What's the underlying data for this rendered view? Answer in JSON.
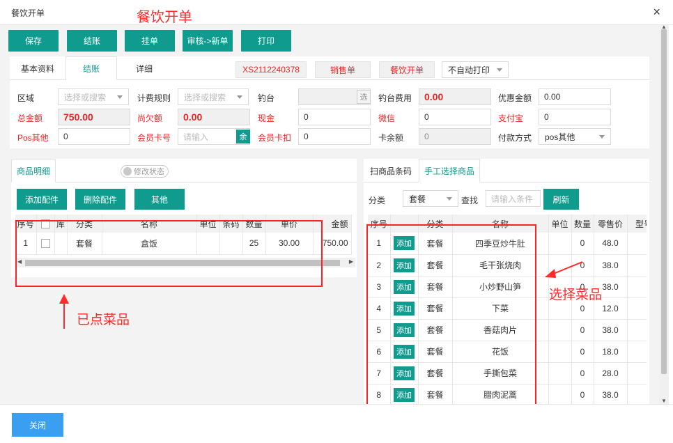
{
  "window": {
    "title": "餐饮开单",
    "close_glyph": "×"
  },
  "annotations": {
    "title": "餐饮开单",
    "ordered_label": "已点菜品",
    "select_label": "选择菜品",
    "color": "#ff2a2a"
  },
  "toolbar": {
    "buttons": [
      "保存",
      "结账",
      "挂单",
      "审核->新单",
      "打印"
    ]
  },
  "top_tabs": [
    "基本资料",
    "结账",
    "详细"
  ],
  "top_chips": [
    "XS2112240378",
    "销售单",
    "餐饮开单"
  ],
  "print_mode": {
    "value": "不自动打印"
  },
  "form": {
    "region": {
      "label": "区域",
      "placeholder": "选择或搜索"
    },
    "billing_rule": {
      "label": "计费规则",
      "placeholder": "选择或搜索"
    },
    "table_seat": {
      "label": "钓台",
      "btn": "选"
    },
    "table_fee": {
      "label": "钓台费用",
      "value": "0.00"
    },
    "discount": {
      "label": "优惠金额",
      "value": "0.00"
    },
    "total": {
      "label": "总金额",
      "value": "750.00"
    },
    "owed": {
      "label": "尚欠额",
      "value": "0.00"
    },
    "cash": {
      "label": "现金",
      "value": "0"
    },
    "wechat": {
      "label": "微信",
      "value": "0"
    },
    "alipay": {
      "label": "支付宝",
      "value": "0"
    },
    "pos_other": {
      "label": "Pos其他",
      "value": "0"
    },
    "member_card": {
      "label": "会员卡号",
      "placeholder": "请输入",
      "btn": "余"
    },
    "member_deduct": {
      "label": "会员卡扣",
      "value": "0"
    },
    "card_balance": {
      "label": "卡余额",
      "value": "0"
    },
    "pay_method": {
      "label": "付款方式",
      "value": "pos其他"
    }
  },
  "left_panel": {
    "tab": "商品明细",
    "toggle_label": "修改状态",
    "buttons": [
      "添加配件",
      "删除配件",
      "其他"
    ],
    "columns": [
      "序号",
      "",
      "库",
      "分类",
      "名称",
      "单位",
      "条码",
      "数量",
      "单价",
      "金额"
    ],
    "rows": [
      {
        "idx": "1",
        "stock": "",
        "category": "套餐",
        "name": "盒饭",
        "unit": "",
        "barcode": "",
        "qty": "25",
        "price": "30.00",
        "amount": "750.00"
      }
    ]
  },
  "right_panel": {
    "tabs": [
      "扫商品条码",
      "手工选择商品"
    ],
    "category_label": "分类",
    "category_value": "套餐",
    "search_label": "查找",
    "search_placeholder": "请输入条件",
    "refresh": "刷新",
    "columns": [
      "序号",
      "",
      "分类",
      "名称",
      "单位",
      "数量",
      "零售价",
      "型号"
    ],
    "add_label": "添加",
    "rows": [
      {
        "idx": "1",
        "category": "套餐",
        "name": "四季豆炒牛肚",
        "unit": "",
        "qty": "0",
        "price": "48.0"
      },
      {
        "idx": "2",
        "category": "套餐",
        "name": "毛干张烧肉",
        "unit": "",
        "qty": "0",
        "price": "38.0"
      },
      {
        "idx": "3",
        "category": "套餐",
        "name": "小炒野山笋",
        "unit": "",
        "qty": "0",
        "price": "38.0"
      },
      {
        "idx": "4",
        "category": "套餐",
        "name": "下菜",
        "unit": "",
        "qty": "0",
        "price": "12.0"
      },
      {
        "idx": "5",
        "category": "套餐",
        "name": "香菇肉片",
        "unit": "",
        "qty": "0",
        "price": "38.0"
      },
      {
        "idx": "6",
        "category": "套餐",
        "name": "花饭",
        "unit": "",
        "qty": "0",
        "price": "18.0"
      },
      {
        "idx": "7",
        "category": "套餐",
        "name": "手撕包菜",
        "unit": "",
        "qty": "0",
        "price": "28.0"
      },
      {
        "idx": "8",
        "category": "套餐",
        "name": "腊肉泥蒿",
        "unit": "",
        "qty": "0",
        "price": "38.0"
      }
    ]
  },
  "footer": {
    "close_label": "关闭"
  }
}
